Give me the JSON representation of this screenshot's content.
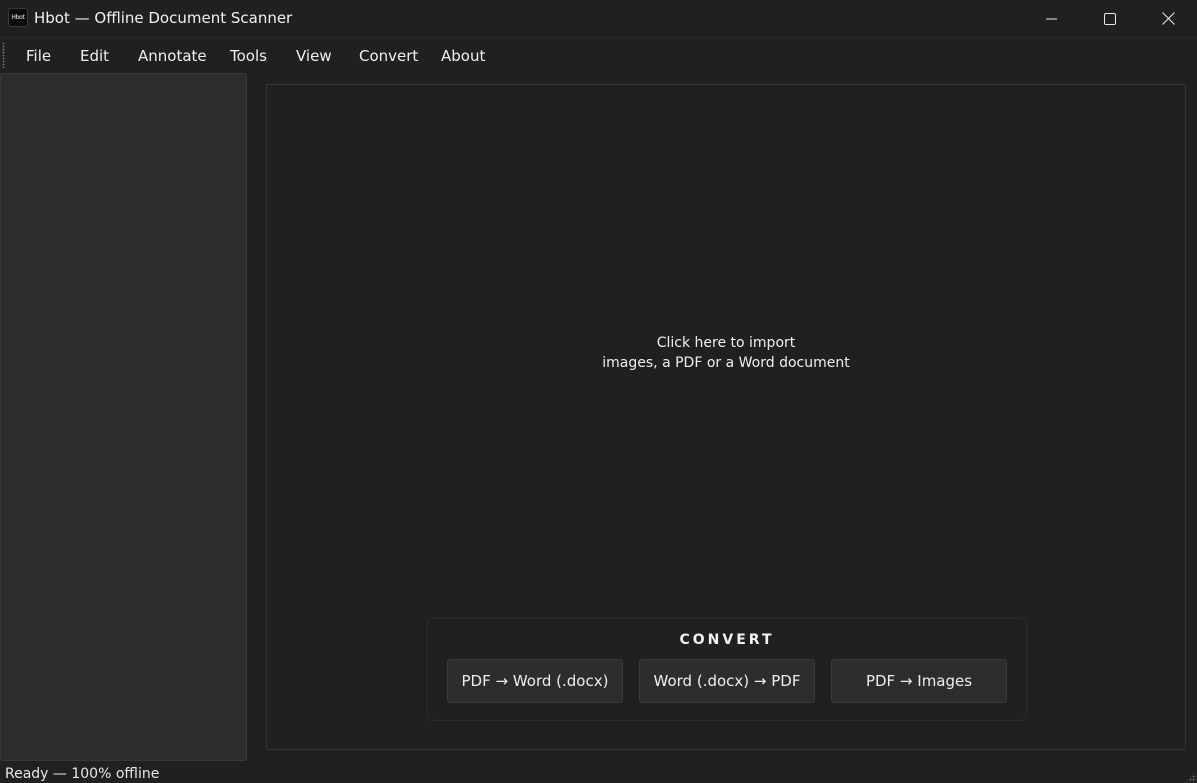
{
  "window": {
    "icon_text": "Hbot",
    "title": "Hbot — Offline Document Scanner",
    "controls": [
      "minimize-icon",
      "maximize-icon",
      "close-icon"
    ]
  },
  "menu": {
    "items": [
      {
        "label": "File"
      },
      {
        "label": "Edit"
      },
      {
        "label": "Annotate"
      },
      {
        "label": "Tools"
      },
      {
        "label": "View"
      },
      {
        "label": "Convert"
      },
      {
        "label": "About"
      }
    ]
  },
  "canvas": {
    "import_line1": "Click here to import",
    "import_line2": "images, a PDF or a Word document"
  },
  "convert": {
    "title": "CONVERT",
    "buttons": [
      {
        "label": "PDF → Word (.docx)"
      },
      {
        "label": "Word (.docx) → PDF"
      },
      {
        "label": "PDF → Images"
      }
    ]
  },
  "status": {
    "text": "Ready — 100% offline"
  },
  "colors": {
    "background": "#202020",
    "sidebar": "#2c2c2c",
    "button": "#2d2d2d",
    "text": "#f0f0f0"
  }
}
